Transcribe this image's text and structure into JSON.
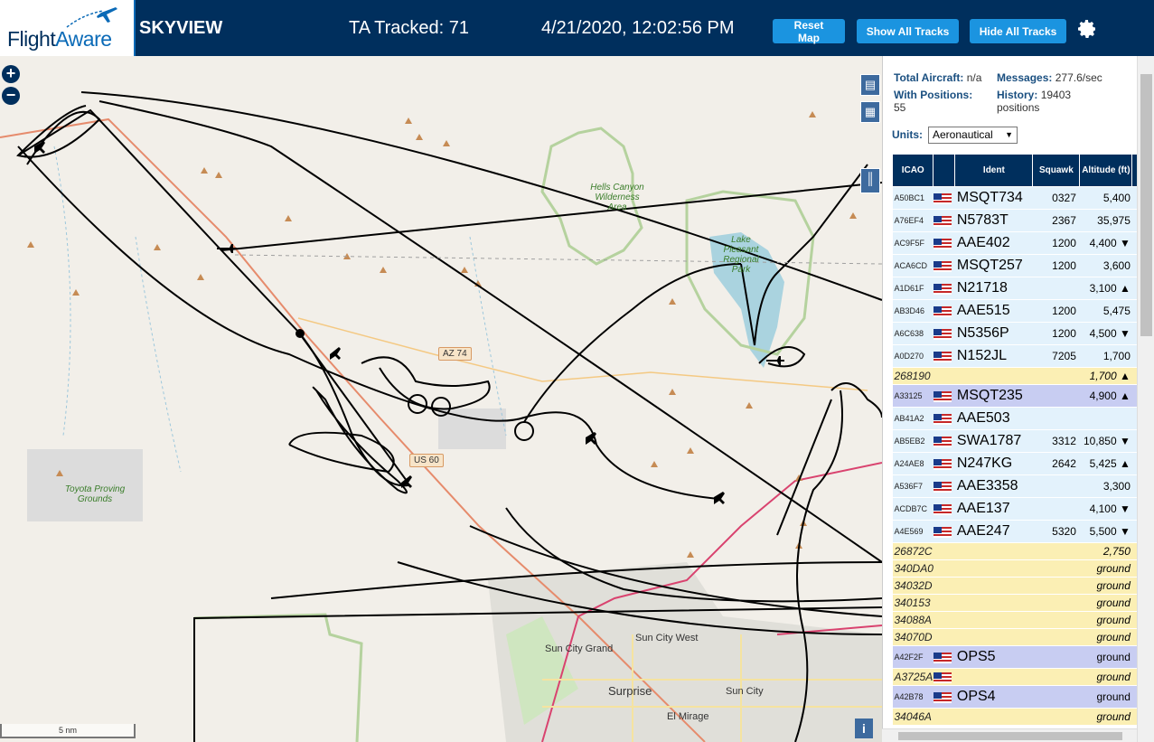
{
  "header": {
    "logo_text_1": "Flight",
    "logo_text_2": "Aware",
    "app_title": "SKYVIEW",
    "tracked": "TA Tracked: 71",
    "datetime": "4/21/2020, 12:02:56 PM",
    "reset_label": "Reset Map",
    "show_label": "Show All Tracks",
    "hide_label": "Hide All Tracks"
  },
  "map": {
    "labels": {
      "hells_canyon": "Hells Canyon Wilderness Area",
      "lake_pleasant": "Lake Pleasant Regional Park",
      "toyota": "Toyota Proving Grounds",
      "sun_city_grand": "Sun City Grand",
      "sun_city_west": "Sun City West",
      "surprise": "Surprise",
      "sun_city": "Sun City",
      "el_mirage": "El Mirage"
    },
    "shields": {
      "az74": "AZ 74",
      "us60": "US 60"
    },
    "scale": "5 nm",
    "info": "i",
    "zoom_in": "+",
    "zoom_out": "−"
  },
  "panel": {
    "total_label": "Total Aircraft:",
    "total_value": "n/a",
    "messages_label": "Messages:",
    "messages_value": "277.6/sec",
    "withpos_label": "With Positions:",
    "withpos_value": "55",
    "history_label": "History:",
    "history_value": "19403 positions",
    "units_label": "Units:",
    "units_value": "Aeronautical"
  },
  "table": {
    "headers": {
      "icao": "ICAO",
      "ident": "Ident",
      "squawk": "Squawk",
      "altitude": "Altitude (ft)"
    },
    "rows": [
      {
        "icao": "A50BC1",
        "flag": true,
        "ident": "MSQT734",
        "squawk": "0327",
        "alt": "5,400",
        "type": "norm"
      },
      {
        "icao": "A76EF4",
        "flag": true,
        "ident": "N5783T",
        "squawk": "2367",
        "alt": "35,975",
        "type": "norm"
      },
      {
        "icao": "AC9F5F",
        "flag": true,
        "ident": "AAE402",
        "squawk": "1200",
        "alt": "4,400 ▼",
        "type": "norm"
      },
      {
        "icao": "ACA6CD",
        "flag": true,
        "ident": "MSQT257",
        "squawk": "1200",
        "alt": "3,600",
        "type": "norm"
      },
      {
        "icao": "A1D61F",
        "flag": true,
        "ident": "N21718",
        "squawk": "",
        "alt": "3,100 ▲",
        "type": "norm"
      },
      {
        "icao": "AB3D46",
        "flag": true,
        "ident": "AAE515",
        "squawk": "1200",
        "alt": "5,475",
        "type": "norm"
      },
      {
        "icao": "A6C638",
        "flag": true,
        "ident": "N5356P",
        "squawk": "1200",
        "alt": "4,500 ▼",
        "type": "norm"
      },
      {
        "icao": "A0D270",
        "flag": true,
        "ident": "N152JL",
        "squawk": "7205",
        "alt": "1,700",
        "type": "norm"
      },
      {
        "icao": "268190",
        "flag": false,
        "ident": "",
        "squawk": "",
        "alt": "1,700 ▲",
        "type": "yel"
      },
      {
        "icao": "A33125",
        "flag": true,
        "ident": "MSQT235",
        "squawk": "",
        "alt": "4,900 ▲",
        "type": "sel"
      },
      {
        "icao": "AB41A2",
        "flag": true,
        "ident": "AAE503",
        "squawk": "",
        "alt": "",
        "type": "norm"
      },
      {
        "icao": "AB5EB2",
        "flag": true,
        "ident": "SWA1787",
        "squawk": "3312",
        "alt": "10,850 ▼",
        "type": "norm"
      },
      {
        "icao": "A24AE8",
        "flag": true,
        "ident": "N247KG",
        "squawk": "2642",
        "alt": "5,425 ▲",
        "type": "norm"
      },
      {
        "icao": "A536F7",
        "flag": true,
        "ident": "AAE3358",
        "squawk": "",
        "alt": "3,300",
        "type": "norm"
      },
      {
        "icao": "ACDB7C",
        "flag": true,
        "ident": "AAE137",
        "squawk": "",
        "alt": "4,100 ▼",
        "type": "norm"
      },
      {
        "icao": "A4E569",
        "flag": true,
        "ident": "AAE247",
        "squawk": "5320",
        "alt": "5,500 ▼",
        "type": "norm"
      },
      {
        "icao": "26872C",
        "flag": false,
        "ident": "",
        "squawk": "",
        "alt": "2,750",
        "type": "yel"
      },
      {
        "icao": "340DA0",
        "flag": false,
        "ident": "",
        "squawk": "",
        "alt": "ground",
        "type": "yel"
      },
      {
        "icao": "34032D",
        "flag": false,
        "ident": "",
        "squawk": "",
        "alt": "ground",
        "type": "yel"
      },
      {
        "icao": "340153",
        "flag": false,
        "ident": "",
        "squawk": "",
        "alt": "ground",
        "type": "yel"
      },
      {
        "icao": "34088A",
        "flag": false,
        "ident": "",
        "squawk": "",
        "alt": "ground",
        "type": "yel"
      },
      {
        "icao": "34070D",
        "flag": false,
        "ident": "",
        "squawk": "",
        "alt": "ground",
        "type": "yel"
      },
      {
        "icao": "A42F2F",
        "flag": true,
        "ident": "OPS5",
        "squawk": "",
        "alt": "ground",
        "type": "sel"
      },
      {
        "icao": "A3725A",
        "flag": true,
        "ident": "",
        "squawk": "",
        "alt": "ground",
        "type": "yel"
      },
      {
        "icao": "A42B78",
        "flag": true,
        "ident": "OPS4",
        "squawk": "",
        "alt": "ground",
        "type": "sel"
      },
      {
        "icao": "34046A",
        "flag": false,
        "ident": "",
        "squawk": "",
        "alt": "ground",
        "type": "yel"
      }
    ]
  },
  "colors": {
    "header_bg": "#002f5d",
    "button": "#1b94e0",
    "row_normal": "#e3f2fc",
    "row_noident": "#fbefb4",
    "row_selected": "#c8cdf2"
  }
}
